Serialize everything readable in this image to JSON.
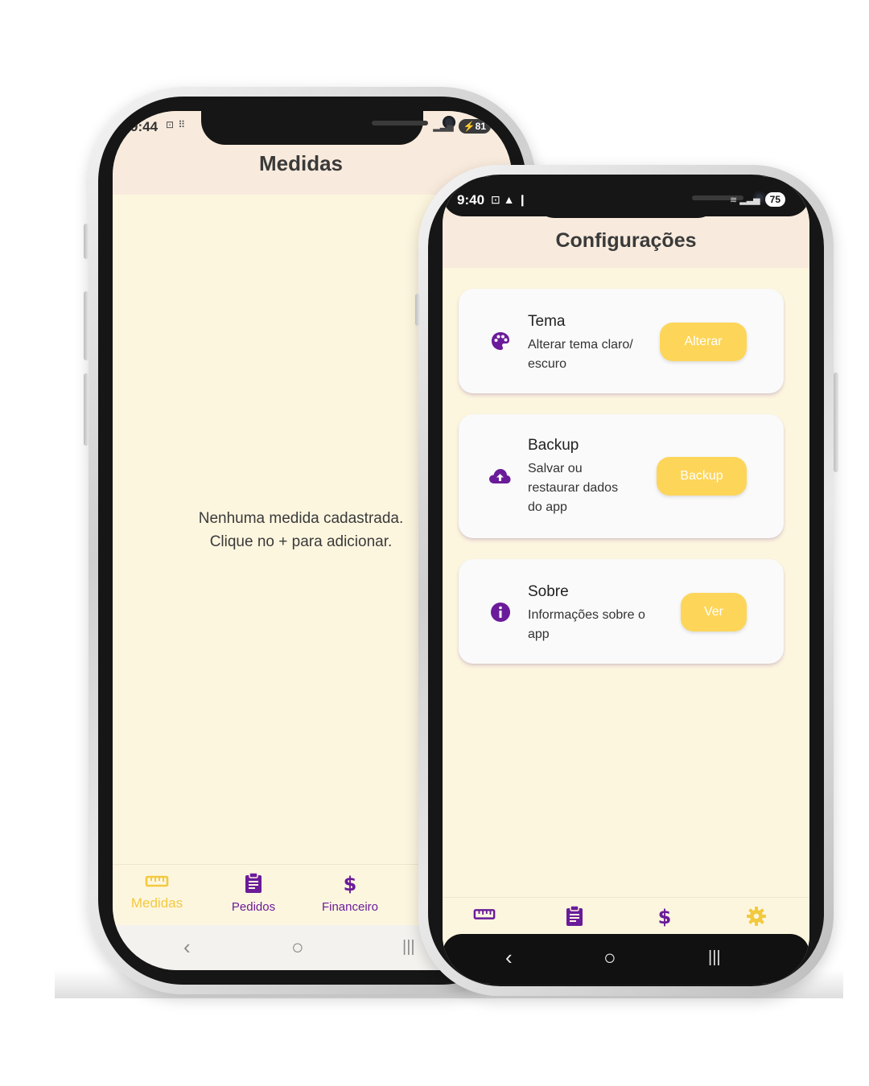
{
  "colors": {
    "accent_purple": "#6a1b9a",
    "accent_yellow": "#fdd559",
    "background": "#fdf6df",
    "appbar": "#f8ebdd"
  },
  "phone_left": {
    "status": {
      "time": "9:44",
      "icons": "⊡ ⠿",
      "battery": "81"
    },
    "title": "Medidas",
    "empty_line1": "Nenhuma medida cadastrada.",
    "empty_line2": "Clique no + para adicionar.",
    "nav": [
      {
        "label": "Medidas",
        "icon": "ruler-icon",
        "active": true
      },
      {
        "label": "Pedidos",
        "icon": "clipboard-icon",
        "active": false
      },
      {
        "label": "Financeiro",
        "icon": "dollar-icon",
        "active": false
      }
    ],
    "system_nav": {
      "back": "‹",
      "home": "○",
      "recents": "|||"
    }
  },
  "phone_right": {
    "status": {
      "time": "9:40",
      "icons": "⊡ ▲ ❙",
      "battery": "75"
    },
    "title": "Configurações",
    "cards": [
      {
        "title": "Tema",
        "subtitle_lines": [
          "Alterar tema claro/",
          "escuro"
        ],
        "button": "Alterar",
        "icon": "palette-icon"
      },
      {
        "title": "Backup",
        "subtitle_lines": [
          "Salvar ou",
          "restaurar dados",
          "do app"
        ],
        "button": "Backup",
        "icon": "cloud-upload-icon"
      },
      {
        "title": "Sobre",
        "subtitle_lines": [
          "Informações sobre o",
          "app"
        ],
        "button": "Ver",
        "icon": "info-icon"
      }
    ],
    "nav": [
      {
        "icon": "ruler-icon",
        "active": false
      },
      {
        "icon": "clipboard-icon",
        "active": false
      },
      {
        "icon": "dollar-icon",
        "active": false
      },
      {
        "icon": "gear-icon",
        "active": true
      }
    ],
    "system_nav": {
      "back": "‹",
      "home": "○",
      "recents": "|||"
    }
  }
}
